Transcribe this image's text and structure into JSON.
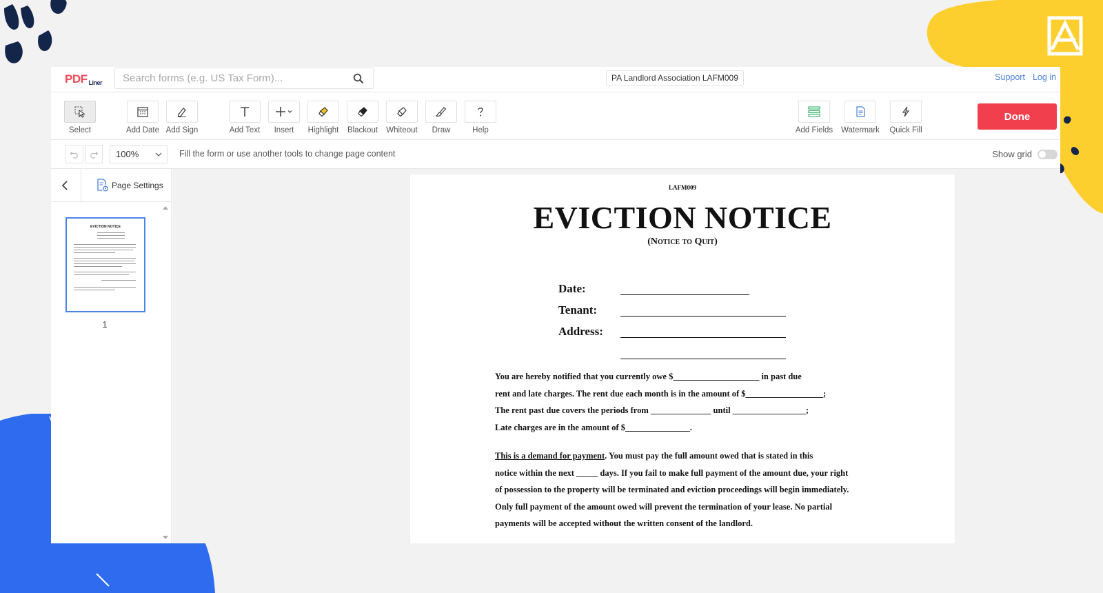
{
  "app": {
    "logo_main": "PDF",
    "logo_sub": "Liner",
    "search_placeholder": "Search forms (e.g. US Tax Form)...",
    "document_title": "PA Landlord Association LAFM009",
    "support_link": "Support",
    "login_link": "Log in"
  },
  "toolbar": {
    "tools": [
      {
        "label": "Select",
        "icon": "cursor-icon"
      },
      {
        "label": "Add Date",
        "icon": "calendar-icon"
      },
      {
        "label": "Add Sign",
        "icon": "pen-icon"
      },
      {
        "label": "Add Text",
        "icon": "text-icon"
      },
      {
        "label": "Insert",
        "icon": "plus-icon"
      },
      {
        "label": "Highlight",
        "icon": "highlighter-icon"
      },
      {
        "label": "Blackout",
        "icon": "blackout-icon"
      },
      {
        "label": "Whiteout",
        "icon": "eraser-icon"
      },
      {
        "label": "Draw",
        "icon": "draw-icon"
      },
      {
        "label": "Help",
        "icon": "question-icon"
      }
    ],
    "right_tools": [
      {
        "label": "Add Fields",
        "icon": "fields-icon"
      },
      {
        "label": "Watermark",
        "icon": "watermark-icon"
      },
      {
        "label": "Quick Fill",
        "icon": "lightning-icon"
      }
    ],
    "done_label": "Done"
  },
  "subbar": {
    "zoom": "100%",
    "hint": "Fill the form or use another tools to change page content",
    "show_grid_label": "Show grid",
    "show_grid_on": false
  },
  "sidebar": {
    "page_settings_label": "Page Settings",
    "thumbnail_title": "EVICTION NOTICE",
    "page_number": "1"
  },
  "document": {
    "form_code": "LAFM009",
    "title": "EVICTION NOTICE",
    "subtitle": "(Notice to Quit)",
    "fields": {
      "date": "Date:",
      "tenant": "Tenant:",
      "address": "Address:"
    },
    "paragraph1": [
      "You are hereby notified that you currently owe $____________________ in past due",
      "rent and late charges.  The rent due each month is in the amount of $__________________;",
      "The rent past due covers the periods from ______________ until _________________;",
      "Late charges are in the amount of $_______________."
    ],
    "paragraph2_lead": "This is a demand for payment",
    "paragraph2_first_rest": ".  You must pay the full amount owed that is stated in this",
    "paragraph2": [
      "notice within the next _____ days.  If you fail to make full payment of the amount due, your right",
      "of possession to the property will be terminated and eviction proceedings will begin immediately.",
      "Only full payment of the amount owed will prevent the termination of your lease.  No partial",
      "payments will be accepted without the written consent of the landlord."
    ]
  },
  "colors": {
    "accent_red": "#f13f4e",
    "link_blue": "#4a7fd8",
    "deco_yellow": "#fccf2f",
    "deco_blue": "#2e6bef",
    "navy": "#14254a"
  }
}
